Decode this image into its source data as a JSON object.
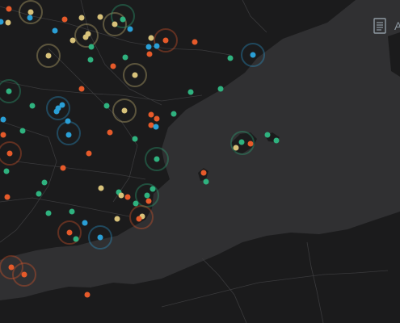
{
  "map": {
    "colors": {
      "sea": "#303032",
      "land": "#1b1b1c",
      "borders": "#3c3c3e",
      "roads": "#2a2a2b"
    },
    "legend_button": {
      "icon": "document-icon",
      "label_fragment": "A"
    },
    "marker_colors": {
      "orange": "#e65a2a",
      "yellow": "#d8c27a",
      "teal": "#2fb27f",
      "blue": "#2a9fd6"
    }
  }
}
